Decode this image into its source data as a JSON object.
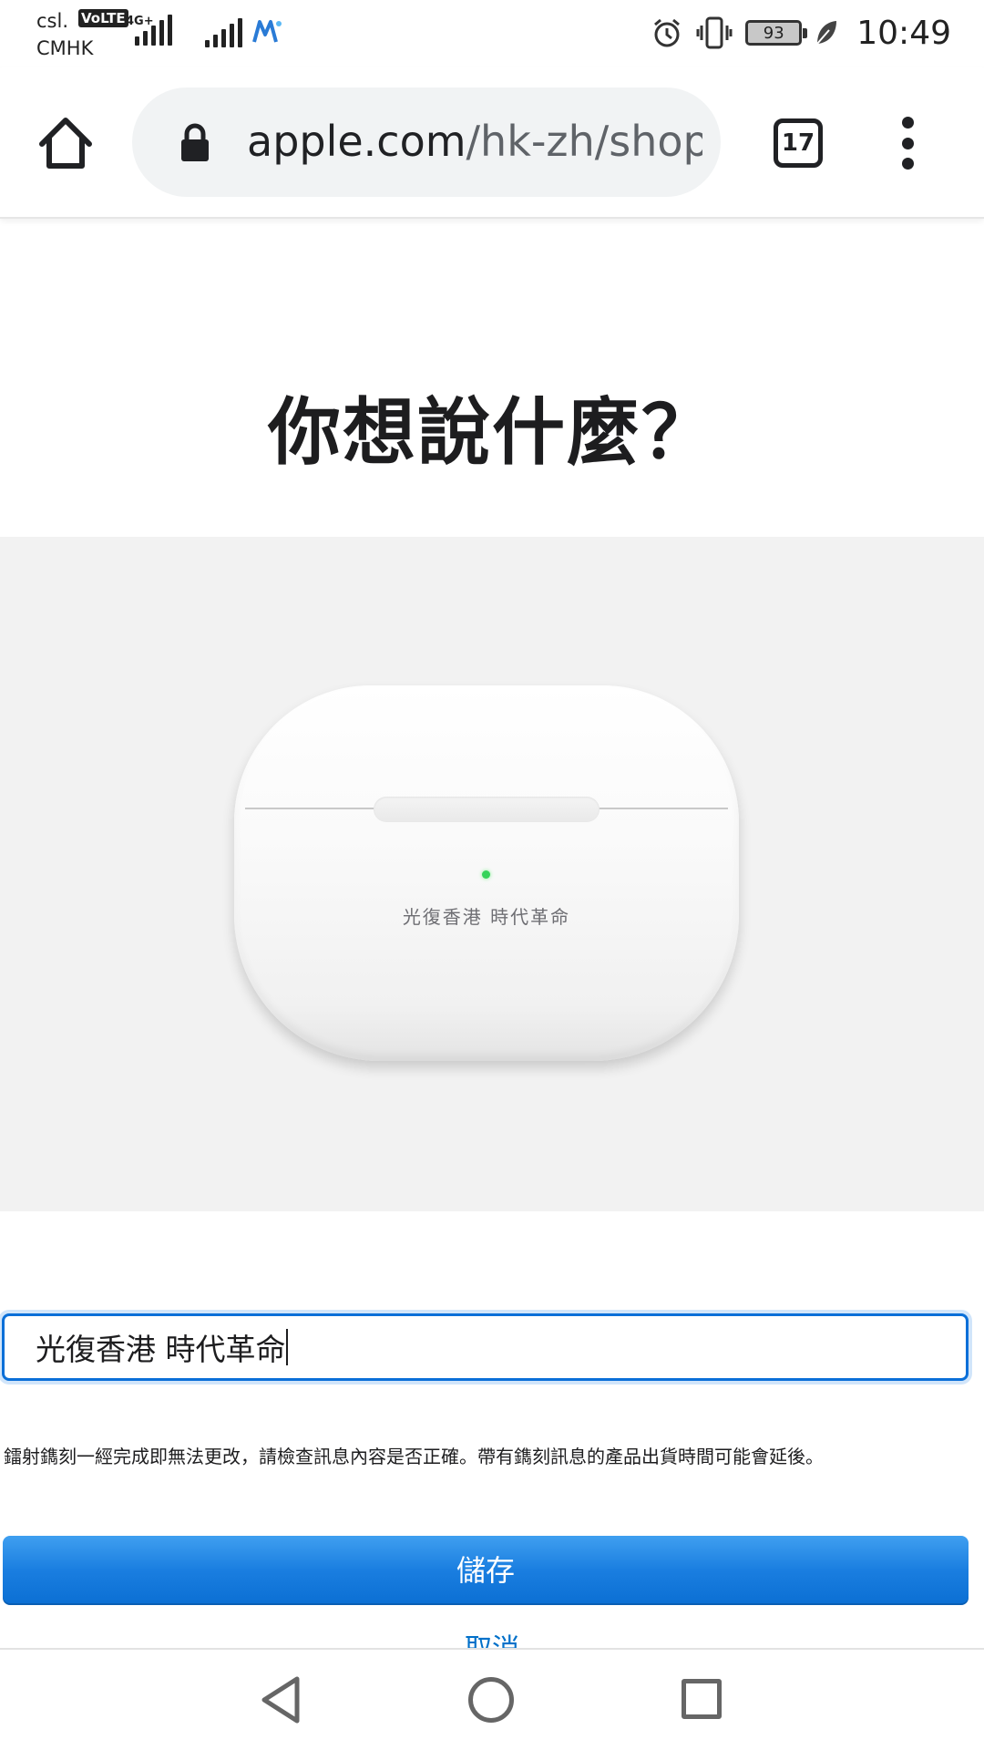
{
  "status_bar": {
    "carrier_line1": "csl.",
    "carrier_line2": "CMHK",
    "volte": "VoLTE",
    "network": "4G+",
    "battery": "93",
    "time": "10:49"
  },
  "browser": {
    "url_domain": "apple.com",
    "url_path": "/hk-zh/shop/",
    "tab_count": "17"
  },
  "page": {
    "title": "你想說什麼？",
    "engraving_preview": "光復香港 時代革命",
    "input_value": "光復香港 時代革命",
    "notice": "鐳射鐫刻一經完成即無法更改，請檢查訊息內容是否正確。帶有鐫刻訊息的產品出貨時間可能會延後。",
    "save_label": "儲存",
    "cancel_label": "取消"
  },
  "colors": {
    "accent": "#0071e3",
    "led": "#35d35a",
    "preview_bg": "#f2f2f2"
  },
  "icons": {
    "home": "home-icon",
    "lock": "lock-icon",
    "tabs": "tab-switcher-icon",
    "menu": "more-vert-icon",
    "alarm": "alarm-icon",
    "vibrate": "vibrate-icon",
    "battery": "battery-icon",
    "leaf": "leaf-icon",
    "back": "nav-back-icon",
    "home_nav": "nav-home-icon",
    "recent": "nav-recents-icon"
  }
}
